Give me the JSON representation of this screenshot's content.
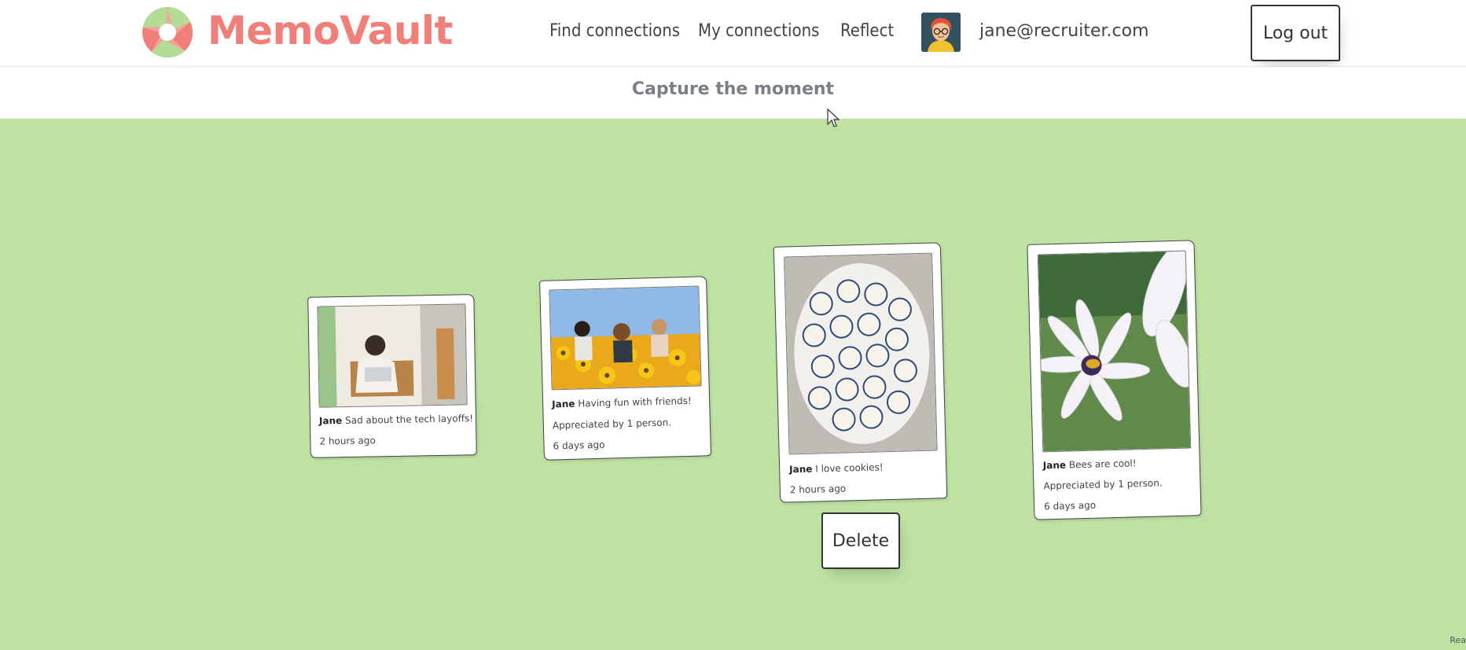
{
  "header": {
    "brand": "MemoVault",
    "nav": {
      "find_connections": "Find connections",
      "my_connections": "My connections",
      "reflect": "Reflect"
    },
    "user_email": "jane@recruiter.com",
    "logout_label": "Log out"
  },
  "subheader": {
    "tagline": "Capture the moment"
  },
  "memories": [
    {
      "author": "Jane",
      "text": "Sad about the tech layoffs!",
      "appreciation": "",
      "time": "2 hours ago"
    },
    {
      "author": "Jane",
      "text": "Having fun with friends!",
      "appreciation": "Appreciated by 1 person.",
      "time": "6 days ago"
    },
    {
      "author": "Jane",
      "text": "I love cookies!",
      "appreciation": "",
      "time": "2 hours ago"
    },
    {
      "author": "Jane",
      "text": "Bees are cool!",
      "appreciation": "Appreciated by 1 person.",
      "time": "6 days ago"
    }
  ],
  "actions": {
    "delete_label": "Delete"
  },
  "corner": "Rea",
  "colors": {
    "brand": "#f07f7a",
    "board_background": "#bee2a2",
    "logo_green": "#b3dc95",
    "text_dark": "#333333",
    "tagline_gray": "#7b7f86"
  },
  "icons": {
    "logo": "aperture-logo-icon",
    "cursor": "mouse-pointer-icon"
  }
}
